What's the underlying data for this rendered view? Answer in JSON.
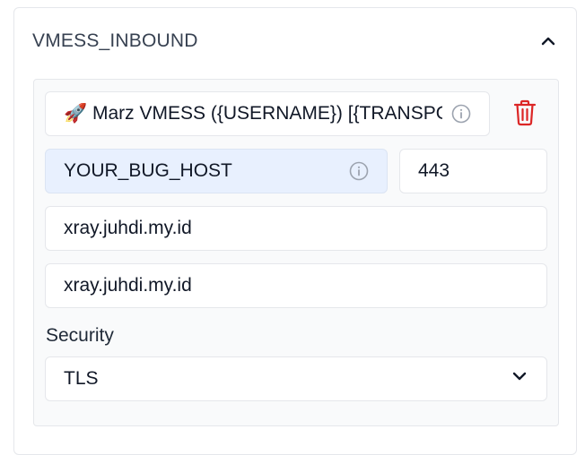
{
  "section": {
    "title": "VMESS_INBOUND"
  },
  "inbound": {
    "remark": "🚀 Marz VMESS ({USERNAME}) [{TRANSPORT}]",
    "host": "YOUR_BUG_HOST",
    "port": "443",
    "sni": "xray.juhdi.my.id",
    "host_header": "xray.juhdi.my.id",
    "security_label": "Security",
    "security_value": "TLS"
  },
  "icons": {
    "collapse": "chevron-up-icon",
    "info": "info-icon",
    "delete": "trash-icon",
    "dropdown": "chevron-down-icon"
  },
  "colors": {
    "delete": "#dc2626",
    "highlight_field": "#e8f0fe",
    "icon_gray": "#9ca3af"
  }
}
